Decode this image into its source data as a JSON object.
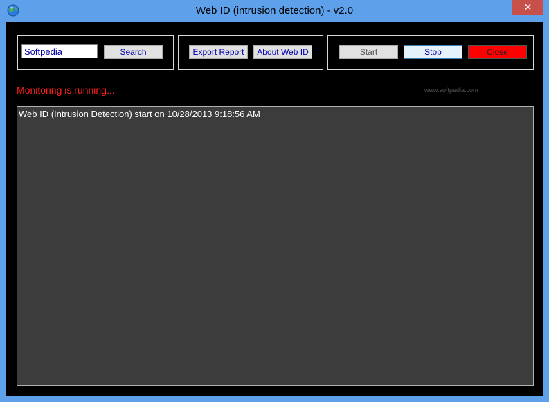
{
  "window": {
    "title": "Web ID (intrusion detection) - v2.0",
    "min_glyph": "—",
    "max_glyph": "☐",
    "close_glyph": "✕"
  },
  "search": {
    "value": "Softpedia",
    "button_label": "Search"
  },
  "report": {
    "export_label": "Export Report",
    "about_label": "About Web ID"
  },
  "control": {
    "start_label": "Start",
    "stop_label": "Stop",
    "close_label": "Close"
  },
  "watermark": "www.softpedia.com",
  "status": {
    "text": "Monitoring is running...",
    "color": "#ff2020"
  },
  "log": {
    "lines": [
      "Web ID (Intrusion Detection) start on 10/28/2013 9:18:56 AM"
    ]
  },
  "icons": {
    "app": "globe-icon"
  }
}
